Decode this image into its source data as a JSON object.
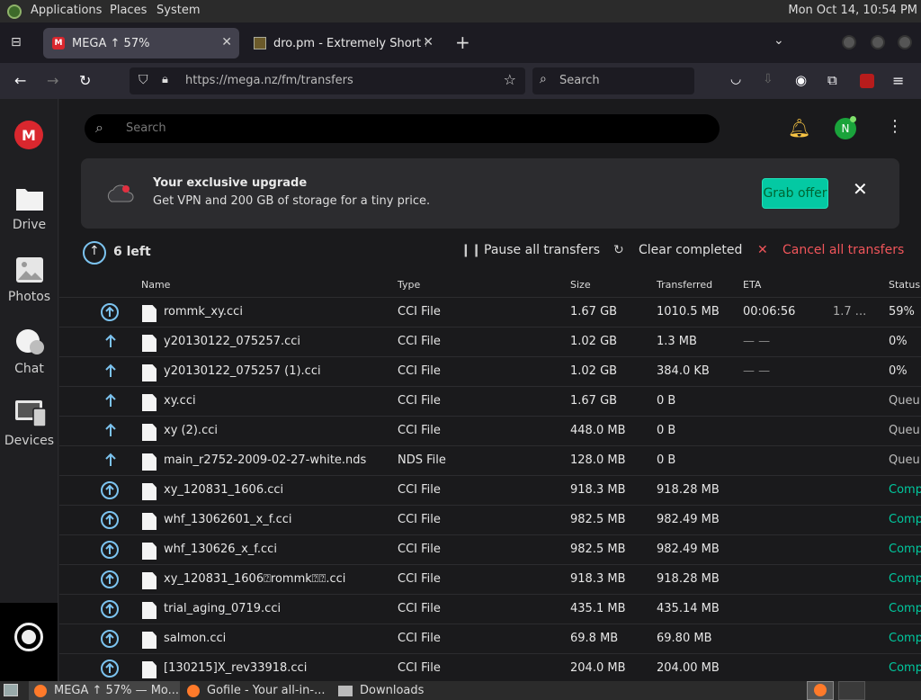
{
  "panel": {
    "menu_applications": "Applications",
    "menu_places": "Places",
    "menu_system": "System",
    "clock": "Mon Oct 14, 10:54 PM"
  },
  "browser": {
    "tabs": [
      {
        "title": "MEGA ↑ 57%",
        "favicon": "mega-favicon",
        "active": true
      },
      {
        "title": "dro.pm - Extremely Short Li",
        "favicon": "dro-favicon",
        "active": false
      }
    ],
    "url": "https://mega.nz/fm/transfers",
    "search_placeholder": "Search"
  },
  "sidebar": {
    "items": [
      {
        "label": "Drive",
        "icon": "folder-icon"
      },
      {
        "label": "Photos",
        "icon": "photos-icon"
      },
      {
        "label": "Chat",
        "icon": "chat-icon"
      },
      {
        "label": "Devices",
        "icon": "devices-icon"
      }
    ]
  },
  "main": {
    "search_placeholder": "Search",
    "avatar_letter": "N",
    "banner": {
      "title": "Your exclusive upgrade",
      "text": "Get VPN and 200 GB of storage for a tiny price.",
      "cta": "Grab offer"
    },
    "transfers": {
      "left_label": "6 left",
      "pause_all": "Pause all transfers",
      "clear_completed": "Clear completed",
      "cancel_all": "Cancel all transfers"
    },
    "columns": [
      "Name",
      "Type",
      "Size",
      "Transferred",
      "ETA",
      "Status"
    ],
    "rows": [
      {
        "name": "rommk_xy.cci",
        "type": "CCI File",
        "size": "1.67 GB",
        "transferred": "1010.5 MB",
        "eta": "00:06:56",
        "speed": "1.7 ...",
        "status": "59%",
        "state": "active"
      },
      {
        "name": "y20130122_075257.cci",
        "type": "CCI File",
        "size": "1.02 GB",
        "transferred": "1.3 MB",
        "eta": "— —",
        "speed": "",
        "status": "0%",
        "state": "active"
      },
      {
        "name": "y20130122_075257 (1).cci",
        "type": "CCI File",
        "size": "1.02 GB",
        "transferred": "384.0 KB",
        "eta": "— —",
        "speed": "",
        "status": "0%",
        "state": "active"
      },
      {
        "name": "xy.cci",
        "type": "CCI File",
        "size": "1.67 GB",
        "transferred": "0 B",
        "eta": "",
        "speed": "",
        "status": "Queu",
        "state": "queued"
      },
      {
        "name": "xy (2).cci",
        "type": "CCI File",
        "size": "448.0 MB",
        "transferred": "0 B",
        "eta": "",
        "speed": "",
        "status": "Queu",
        "state": "queued"
      },
      {
        "name": "main_r2752-2009-02-27-white.nds",
        "type": "NDS File",
        "size": "128.0 MB",
        "transferred": "0 B",
        "eta": "",
        "speed": "",
        "status": "Queu",
        "state": "queued"
      },
      {
        "name": "xy_120831_1606.cci",
        "type": "CCI File",
        "size": "918.3 MB",
        "transferred": "918.28 MB",
        "eta": "",
        "speed": "",
        "status": "Comp",
        "state": "complete"
      },
      {
        "name": "whf_13062601_x_f.cci",
        "type": "CCI File",
        "size": "982.5 MB",
        "transferred": "982.49 MB",
        "eta": "",
        "speed": "",
        "status": "Comp",
        "state": "complete"
      },
      {
        "name": "whf_130626_x_f.cci",
        "type": "CCI File",
        "size": "982.5 MB",
        "transferred": "982.49 MB",
        "eta": "",
        "speed": "",
        "status": "Comp",
        "state": "complete"
      },
      {
        "name": "xy_120831_1606⍰rommk⍰⍰.cci",
        "type": "CCI File",
        "size": "918.3 MB",
        "transferred": "918.28 MB",
        "eta": "",
        "speed": "",
        "status": "Comp",
        "state": "complete"
      },
      {
        "name": "trial_aging_0719.cci",
        "type": "CCI File",
        "size": "435.1 MB",
        "transferred": "435.14 MB",
        "eta": "",
        "speed": "",
        "status": "Comp",
        "state": "complete"
      },
      {
        "name": "salmon.cci",
        "type": "CCI File",
        "size": "69.8 MB",
        "transferred": "69.80 MB",
        "eta": "",
        "speed": "",
        "status": "Comp",
        "state": "complete"
      },
      {
        "name": "[130215]X_rev33918.cci",
        "type": "CCI File",
        "size": "204.0 MB",
        "transferred": "204.00 MB",
        "eta": "",
        "speed": "",
        "status": "Comp",
        "state": "complete"
      }
    ]
  },
  "taskbar": {
    "items": [
      {
        "label": "MEGA ↑ 57% — Mo...",
        "icon": "firefox-icon",
        "active": true
      },
      {
        "label": "Gofile - Your all-in-...",
        "icon": "firefox-icon",
        "active": false
      },
      {
        "label": "Downloads",
        "icon": "folder-icon",
        "active": false
      }
    ]
  },
  "colors": {
    "mega_red": "#d9272e",
    "accent_teal": "#00c89e",
    "cancel_red": "#f0555a",
    "upload_blue": "#7cc3ef"
  }
}
